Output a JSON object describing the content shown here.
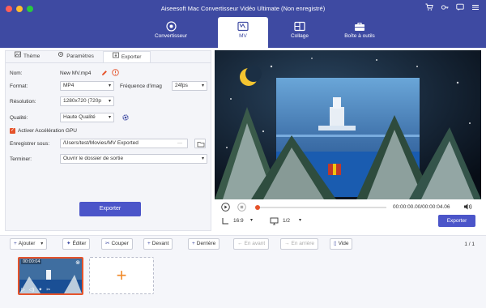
{
  "window": {
    "title": "Aiseesoft Mac Convertisseur Vidéo Ultimate (Non enregistré)",
    "titlebar_icons": [
      "cart-icon",
      "key-icon",
      "chat-icon",
      "menu-icon"
    ]
  },
  "nav": {
    "tabs": [
      {
        "label": "Convertisseur",
        "icon": "convert-icon"
      },
      {
        "label": "MV",
        "icon": "mv-icon",
        "active": true
      },
      {
        "label": "Collage",
        "icon": "collage-icon"
      },
      {
        "label": "Boîte à outils",
        "icon": "toolbox-icon"
      }
    ]
  },
  "left_panel": {
    "subtabs": [
      {
        "label": "Thème",
        "icon": "theme-icon"
      },
      {
        "label": "Paramètres",
        "icon": "settings-icon"
      },
      {
        "label": "Exporter",
        "icon": "export-icon",
        "active": true
      }
    ],
    "name_label": "Nom:",
    "name_value": "New MV.mp4",
    "format_label": "Format:",
    "format_value": "MP4",
    "fps_label": "Fréquence d'imag",
    "fps_value": "24fps",
    "resolution_label": "Résolution:",
    "resolution_value": "1280x720 (720p",
    "quality_label": "Qualité:",
    "quality_value": "Haute Qualité",
    "gpu_label": "Activer Accélération GPU",
    "gpu_checked": true,
    "save_label": "Enregistrer sous:",
    "save_path": "/Users/test/Movies/MV Exported",
    "save_more": "···",
    "finish_label": "Terminer:",
    "finish_value": "Ouvrir le dossier de sortie",
    "export_button": "Exporter"
  },
  "player": {
    "time": "00:00:00.00/00:00:04.06",
    "aspect": "16:9",
    "page": "1/2",
    "export_button": "Exporter"
  },
  "toolbar": {
    "add": "Ajouter",
    "edit": "Éditer",
    "cut": "Couper",
    "front": "Devant",
    "back": "Derrière",
    "forward": "En avant",
    "backward": "En arrière",
    "empty": "Vide",
    "page_count": "1 / 1"
  },
  "timeline": {
    "clip_duration": "00:00:04"
  },
  "colors": {
    "brand": "#3e4aa2",
    "accent": "#4b55c9",
    "warning": "#e5532b"
  }
}
